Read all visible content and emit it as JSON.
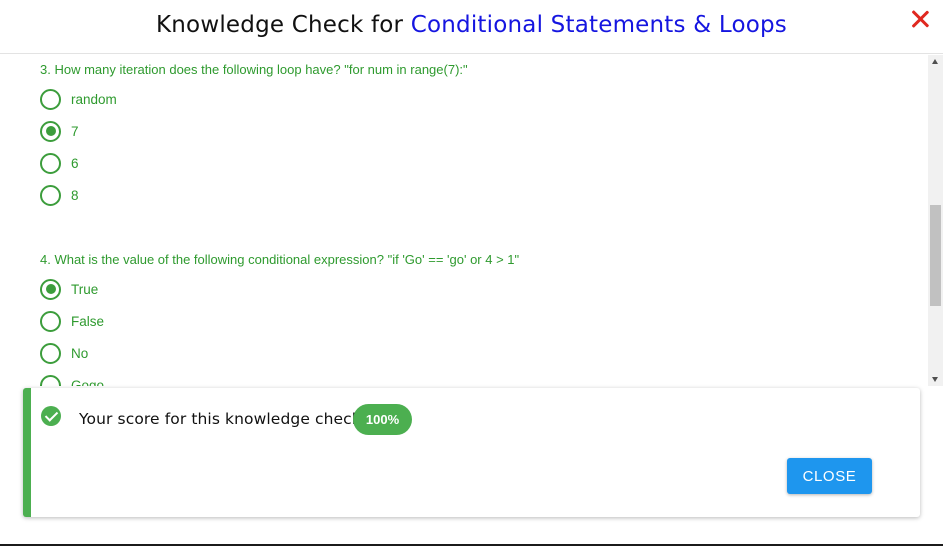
{
  "header": {
    "title_prefix": "Knowledge Check for",
    "title_topic": "Conditional Statements & Loops",
    "close_icon": "close-x-icon",
    "topic_color": "#1515e0",
    "close_color": "#e0281f"
  },
  "questions": [
    {
      "text": "3. How many iteration does the following loop have? \"for num in range(7):\"",
      "options": [
        {
          "label": "random",
          "checked": false
        },
        {
          "label": "7",
          "checked": true
        },
        {
          "label": "6",
          "checked": false
        },
        {
          "label": "8",
          "checked": false
        }
      ]
    },
    {
      "text": "4. What is the value of the following conditional expression? \"if 'Go' == 'go' or 4 > 1\"",
      "options": [
        {
          "label": "True",
          "checked": true
        },
        {
          "label": "False",
          "checked": false
        },
        {
          "label": "No",
          "checked": false
        },
        {
          "label": "Gogo",
          "checked": false
        }
      ]
    }
  ],
  "result": {
    "icon": "check-circle-icon",
    "message": "Your score for this knowledge check:",
    "score": "100%",
    "close_label": "CLOSE",
    "accent_color": "#4caf50",
    "button_color": "#1e96ee"
  },
  "answer_color": "#2e9a2e"
}
